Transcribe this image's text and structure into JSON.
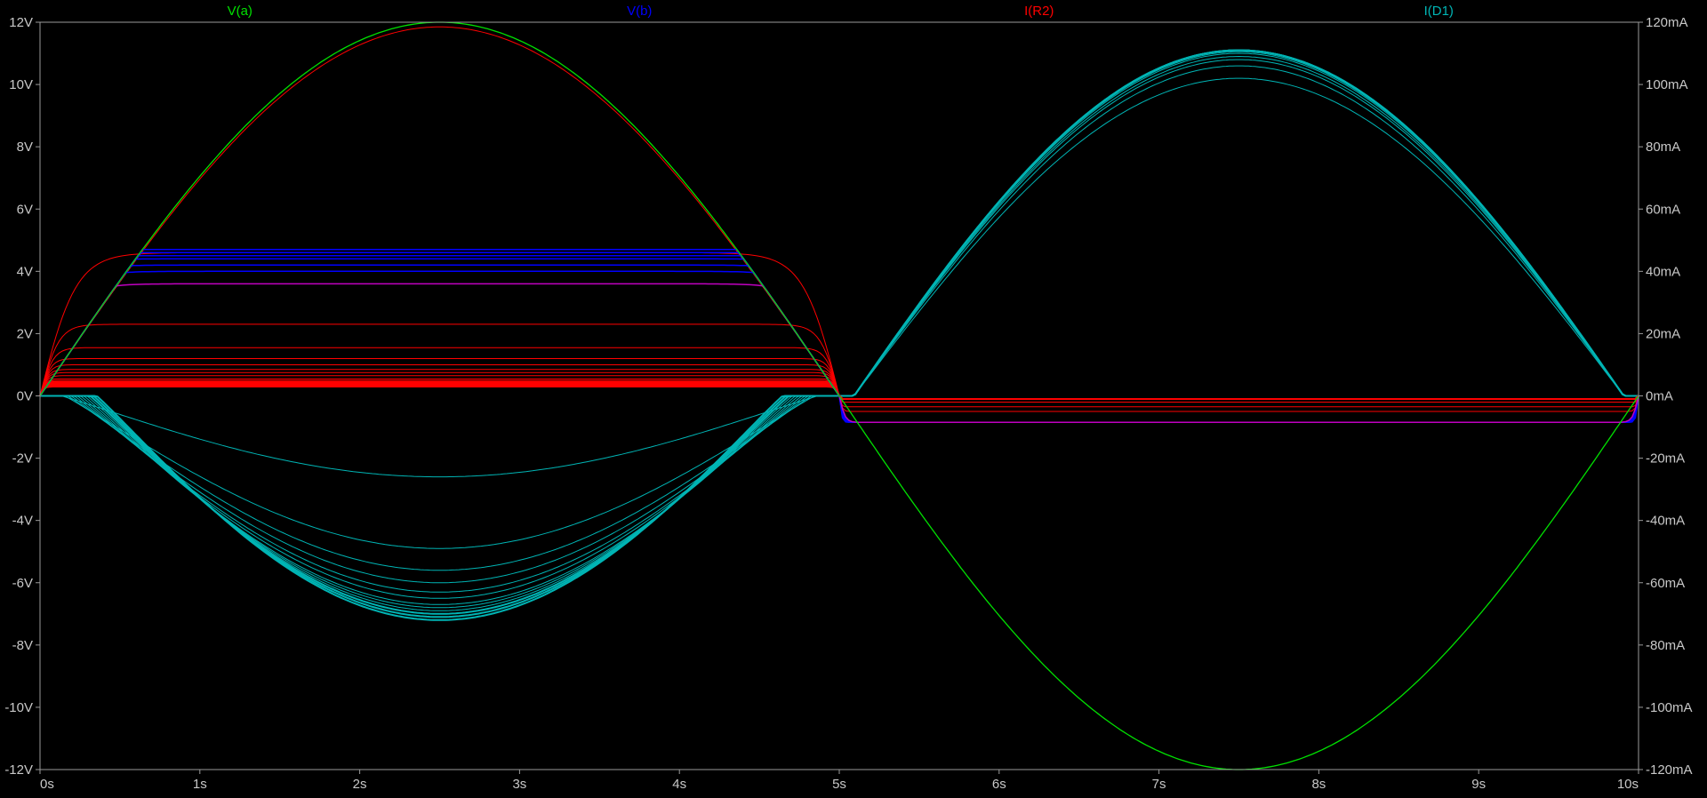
{
  "chart_data": {
    "type": "line",
    "title": "",
    "xlabel": "",
    "ylabel": "",
    "x_range": [
      0,
      10
    ],
    "x_ticks": [
      "0s",
      "1s",
      "2s",
      "3s",
      "4s",
      "5s",
      "6s",
      "7s",
      "8s",
      "9s",
      "10s"
    ],
    "y_left_range": [
      -12,
      12
    ],
    "y_left_ticks": [
      "12V",
      "10V",
      "8V",
      "6V",
      "4V",
      "2V",
      "0V",
      "-2V",
      "-4V",
      "-6V",
      "-8V",
      "-10V",
      "-12V"
    ],
    "y_right_range": [
      -120,
      120
    ],
    "y_right_ticks": [
      "120mA",
      "100mA",
      "80mA",
      "60mA",
      "40mA",
      "20mA",
      "0mA",
      "-20mA",
      "-40mA",
      "-60mA",
      "-80mA",
      "-100mA",
      "-120mA"
    ],
    "grid": false,
    "legend_placement": "top",
    "background_color": "#000000",
    "axis_color": "#9a9a9a",
    "series": [
      {
        "name": "V(a)",
        "color": "#00e000",
        "axis": "left",
        "amplitude": 12,
        "period": 10,
        "description_values": {
          "peak_x": 2.5,
          "peak": 12,
          "trough_x": 7.5,
          "trough": -12
        }
      },
      {
        "name": "V(b)",
        "color": "#0000ff",
        "axis": "left",
        "clip_levels": [
          4.7,
          4.6,
          4.5,
          4.4,
          4.2,
          4.0,
          3.6
        ],
        "negative_clip": -0.85
      },
      {
        "name": "I(R2)",
        "color": "#ff0000",
        "axis": "left",
        "step_levels": [
          11.85,
          4.6,
          2.3,
          1.55,
          1.2,
          1.0,
          0.85,
          0.75,
          0.65,
          0.55,
          0.5,
          0.45,
          0.4,
          0.35,
          0.3
        ],
        "negative_levels": [
          -0.85,
          -0.5,
          -0.35,
          -0.2,
          -0.1
        ]
      },
      {
        "name": "I(D1)",
        "color": "#00b4b4",
        "axis": "right",
        "negative_peaks": [
          -26,
          -49,
          -56,
          -60,
          -63,
          -65,
          -67,
          -68,
          -69,
          -70,
          -71,
          -72
        ],
        "positive_peaks": [
          102,
          106,
          108,
          109,
          110,
          110.5,
          111
        ]
      }
    ]
  }
}
